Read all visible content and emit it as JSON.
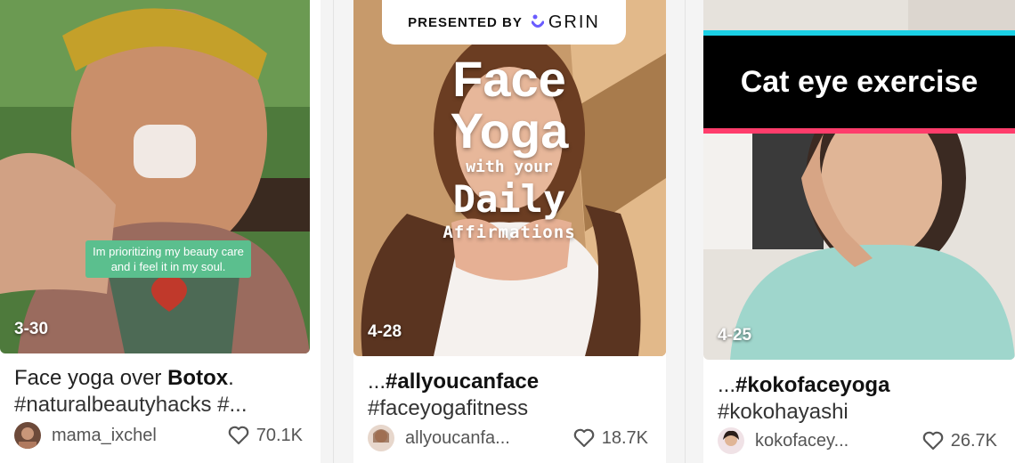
{
  "cards": [
    {
      "date": "3-30",
      "overlay_caption": "Im prioritizing my beauty care and i feel it in my soul.",
      "caption_line1_plain": "Face yoga over ",
      "caption_line1_bold": "Botox",
      "caption_line1_tail": ".",
      "caption_line2": "#naturalbeautyhacks #...",
      "username": "mama_ixchel",
      "likes": "70.1K",
      "icons": [
        "avatar",
        "heart-icon"
      ]
    },
    {
      "date": "4-28",
      "presented_by": "PRESENTED BY",
      "brand": "GRIN",
      "overlay_title": {
        "line1": "Face",
        "line2": "Yoga",
        "line3": "with your",
        "line4": "Daily",
        "line5": "Affirmations"
      },
      "caption_line1_plain": "...",
      "caption_line1_bold": "#allyoucanface",
      "caption_line2": "#faceyogafitness",
      "username": "allyoucanfa...",
      "likes": "18.7K",
      "icons": [
        "grin-logo-icon",
        "avatar",
        "heart-icon"
      ]
    },
    {
      "date": "4-25",
      "banner": "Cat eye exercise",
      "caption_line1_plain": "...",
      "caption_line1_bold": "#kokofaceyoga",
      "caption_line2": "#kokohayashi",
      "username": "kokofacey...",
      "likes": "26.7K",
      "icons": [
        "avatar",
        "heart-icon"
      ]
    }
  ],
  "colors": {
    "banner_top": "#1bd0e5",
    "banner_bottom": "#ff3d6b",
    "subtitle_pill": "#5bbf8e",
    "grin_brand": "#6a5cff"
  }
}
